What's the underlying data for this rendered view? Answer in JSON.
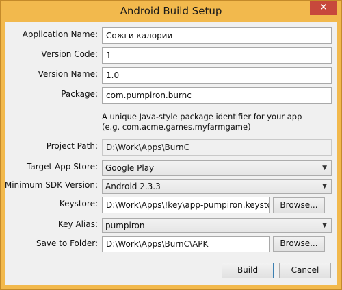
{
  "window": {
    "title": "Android Build Setup",
    "close_glyph": "✕"
  },
  "form": {
    "application_name": {
      "label": "Application Name:",
      "value": "Сожги калории"
    },
    "version_code": {
      "label": "Version Code:",
      "value": "1"
    },
    "version_name": {
      "label": "Version Name:",
      "value": "1.0"
    },
    "package": {
      "label": "Package:",
      "value": "com.pumpiron.burnc",
      "hint_line1": "A unique Java-style package identifier for your app",
      "hint_line2": "(e.g. com.acme.games.myfarmgame)"
    },
    "project_path": {
      "label": "Project Path:",
      "value": "D:\\Work\\Apps\\BurnC"
    },
    "target_app_store": {
      "label": "Target App Store:",
      "value": "Google Play"
    },
    "min_sdk": {
      "label": "Minimum SDK Version:",
      "value": "Android 2.3.3"
    },
    "keystore": {
      "label": "Keystore:",
      "value": "D:\\Work\\Apps\\!key\\app-pumpiron.keystore",
      "browse_label": "Browse..."
    },
    "key_alias": {
      "label": "Key Alias:",
      "value": "pumpiron"
    },
    "save_folder": {
      "label": "Save to Folder:",
      "value": "D:\\Work\\Apps\\BurnC\\APK",
      "browse_label": "Browse..."
    }
  },
  "buttons": {
    "build": "Build",
    "cancel": "Cancel"
  },
  "colors": {
    "frame": "#f2b94d",
    "close_button": "#c7483c",
    "client_bg": "#f0f0f0",
    "default_button_border": "#3c7fb1"
  },
  "icons": {
    "dropdown": "chevron-down-icon"
  }
}
